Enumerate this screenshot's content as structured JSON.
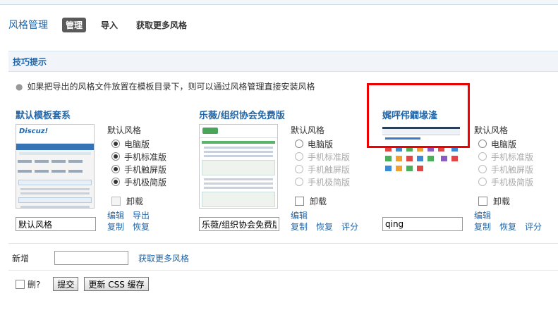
{
  "header": {
    "title": "风格管理",
    "tabs": [
      {
        "label": "管理",
        "active": true
      },
      {
        "label": "导入",
        "active": false
      },
      {
        "label": "获取更多风格",
        "active": false
      }
    ]
  },
  "tips": {
    "heading": "技巧提示",
    "text": "如果把导出的风格文件放置在模板目录下，则可以通过风格管理直接安装风格"
  },
  "themes": [
    {
      "name": "默认模板套系",
      "input_value": "默认风格",
      "default_label": "默认风格",
      "options": [
        {
          "label": "电脑版",
          "checked": true,
          "disabled": false
        },
        {
          "label": "手机标准版",
          "checked": true,
          "disabled": false
        },
        {
          "label": "手机触屏版",
          "checked": true,
          "disabled": false
        },
        {
          "label": "手机极简版",
          "checked": true,
          "disabled": false
        }
      ],
      "uninstall_label": "卸载",
      "uninstall_disabled": true,
      "actions": [
        "编辑",
        "导出",
        "复制",
        "恢复"
      ]
    },
    {
      "name": "乐薇/组织协会免费版",
      "input_value": "乐薇/组织协会免费版",
      "default_label": "默认风格",
      "options": [
        {
          "label": "电脑版",
          "checked": false,
          "disabled": false
        },
        {
          "label": "手机标准版",
          "checked": false,
          "disabled": true
        },
        {
          "label": "手机触屏版",
          "checked": false,
          "disabled": true
        },
        {
          "label": "手机极简版",
          "checked": false,
          "disabled": true
        }
      ],
      "uninstall_label": "卸载",
      "uninstall_disabled": false,
      "actions": [
        "编辑",
        "复制",
        "恢复",
        "评分"
      ]
    },
    {
      "name": "娓呯伄鐗堟湰",
      "input_value": "qing",
      "default_label": "默认风格",
      "options": [
        {
          "label": "电脑版",
          "checked": false,
          "disabled": false
        },
        {
          "label": "手机标准版",
          "checked": false,
          "disabled": true
        },
        {
          "label": "手机触屏版",
          "checked": false,
          "disabled": true
        },
        {
          "label": "手机极简版",
          "checked": false,
          "disabled": true
        }
      ],
      "uninstall_label": "卸载",
      "uninstall_disabled": false,
      "actions": [
        "编辑",
        "复制",
        "恢复",
        "评分"
      ]
    }
  ],
  "add_row": {
    "label": "新增",
    "link": "获取更多风格"
  },
  "submit_row": {
    "delete_label": "删?",
    "submit_label": "提交",
    "update_css_label": "更新 CSS 缓存"
  },
  "colors": {
    "link": "#2366a8",
    "highlight_box": "#ee0000"
  }
}
